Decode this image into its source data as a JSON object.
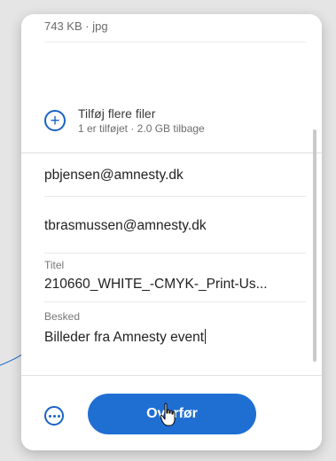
{
  "file": {
    "meta": "743 KB · jpg"
  },
  "add_files": {
    "title": "Tilføj flere filer",
    "subtitle": "1 er tilføjet · 2.0 GB tilbage",
    "icon": "plus-circle-icon"
  },
  "recipients": [
    "pbjensen@amnesty.dk",
    "tbrasmussen@amnesty.dk"
  ],
  "title_field": {
    "label": "Titel",
    "value": "210660_WHITE_-CMYK-_Print-Us..."
  },
  "message_field": {
    "label": "Besked",
    "value": "Billeder fra Amnesty event"
  },
  "actions": {
    "transfer_label": "Overfør",
    "more_icon": "more-options-icon"
  },
  "colors": {
    "accent": "#1f6fd3",
    "icon_blue": "#1a63c5",
    "backdrop": "#e5e5e6"
  }
}
